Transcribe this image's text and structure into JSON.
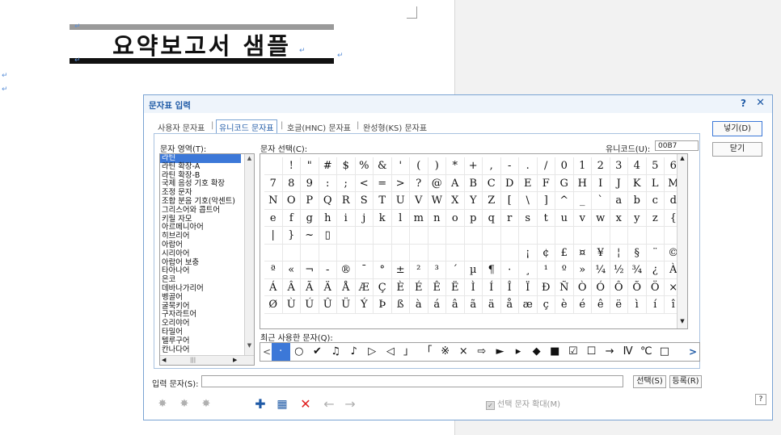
{
  "document": {
    "title": "요약보고서 샘플",
    "para_mark": "↵"
  },
  "dialog": {
    "title": "문자표 입력",
    "help": "?",
    "close": "✕",
    "tabs": [
      "사용자 문자표",
      "유니코드 문자표",
      "호글(HNC) 문자표",
      "완성형(KS) 문자표"
    ],
    "tab_separator": "|",
    "active_tab": "유니코드 문자표",
    "area_label": "문자 영역(T):",
    "select_label": "문자 선택(C):",
    "unicode_label": "유니코드(U):",
    "unicode_value": "00B7",
    "recent_label": "최근 사용한 문자(Q):",
    "input_label": "입력 문자(S):",
    "insert_button": "넣기(D)",
    "close_button": "닫기",
    "select_button": "선택(S)",
    "register_button": "등록(R)",
    "enlarge_label": "선택 문자 확대(M)",
    "help_button": "?",
    "scroll_thumb": "|||",
    "scroll_up": "▲",
    "scroll_down": "▼",
    "scroll_left": "◀",
    "scroll_right": "▶",
    "categories": [
      "라틴",
      "라틴 확장-A",
      "라틴 확장-B",
      "국제 음성 기호 확장",
      "조정 문자",
      "조합 분음 기호(악센트)",
      "그리스어와 콥트어",
      "키릴 자모",
      "아르메니아어",
      "히브리어",
      "아랍어",
      "시리아어",
      "아랍어 보충",
      "타아나어",
      "은코",
      "데바나가리어",
      "벵골어",
      "굴묵키어",
      "구자라트어",
      "오리야어",
      "타밀어",
      "텔루구어",
      "칸나다어"
    ],
    "selected_category": "라틴",
    "grid_rows": [
      [
        "",
        "!",
        "\"",
        "#",
        "$",
        "%",
        "&",
        "'",
        "(",
        ")",
        "*",
        "+",
        ",",
        "-",
        ".",
        "/",
        "0",
        "1",
        "2",
        "3",
        "4",
        "5",
        "6"
      ],
      [
        "7",
        "8",
        "9",
        ":",
        ";",
        "<",
        "=",
        ">",
        "?",
        "@",
        "A",
        "B",
        "C",
        "D",
        "E",
        "F",
        "G",
        "H",
        "I",
        "J",
        "K",
        "L",
        "M"
      ],
      [
        "N",
        "O",
        "P",
        "Q",
        "R",
        "S",
        "T",
        "U",
        "V",
        "W",
        "X",
        "Y",
        "Z",
        "[",
        "\\",
        "]",
        "^",
        "_",
        "`",
        "a",
        "b",
        "c",
        "d"
      ],
      [
        "e",
        "f",
        "g",
        "h",
        "i",
        "j",
        "k",
        "l",
        "m",
        "n",
        "o",
        "p",
        "q",
        "r",
        "s",
        "t",
        "u",
        "v",
        "w",
        "x",
        "y",
        "z",
        "{"
      ],
      [
        "|",
        "}",
        "~",
        "▯",
        "",
        "",
        "",
        "",
        "",
        "",
        "",
        "",
        "",
        "",
        "",
        "",
        "",
        "",
        "",
        "",
        "",
        "",
        ""
      ],
      [
        "",
        "",
        "",
        "",
        "",
        "",
        "",
        "",
        "",
        "",
        "",
        "",
        "",
        "",
        "",
        "",
        "¡",
        "¢",
        "£",
        "¤",
        "¥",
        "¦",
        "§",
        "¨",
        "©"
      ],
      [
        "ª",
        "«",
        "¬",
        "-",
        "®",
        "¯",
        "°",
        "±",
        "²",
        "³",
        "´",
        "µ",
        "¶",
        "·",
        "¸",
        "¹",
        "º",
        "»",
        "¼",
        "½",
        "¾",
        "¿",
        "À"
      ],
      [
        "Á",
        "Â",
        "Ã",
        "Ä",
        "Å",
        "Æ",
        "Ç",
        "È",
        "É",
        "Ê",
        "Ë",
        "Ì",
        "Í",
        "Î",
        "Ï",
        "Ð",
        "Ñ",
        "Ò",
        "Ó",
        "Ô",
        "Õ",
        "Ö",
        "×"
      ],
      [
        "Ø",
        "Ù",
        "Ú",
        "Û",
        "Ü",
        "Ý",
        "Þ",
        "ß",
        "à",
        "á",
        "â",
        "ã",
        "ä",
        "å",
        "æ",
        "ç",
        "è",
        "é",
        "ê",
        "ë",
        "ì",
        "í",
        "î"
      ]
    ],
    "recent_chars": [
      "·",
      "○",
      "✔",
      "♫",
      "♪",
      "▷",
      "◁",
      "」",
      "「",
      "※",
      "×",
      "⇨",
      "►",
      "▸",
      "◆",
      "■",
      "☑",
      "☐",
      "→",
      "Ⅳ",
      "℃",
      "□"
    ],
    "recent_prev": "<",
    "recent_next": ">",
    "toolbar": [
      "✚",
      "▦",
      "✕",
      "←",
      "→"
    ]
  }
}
